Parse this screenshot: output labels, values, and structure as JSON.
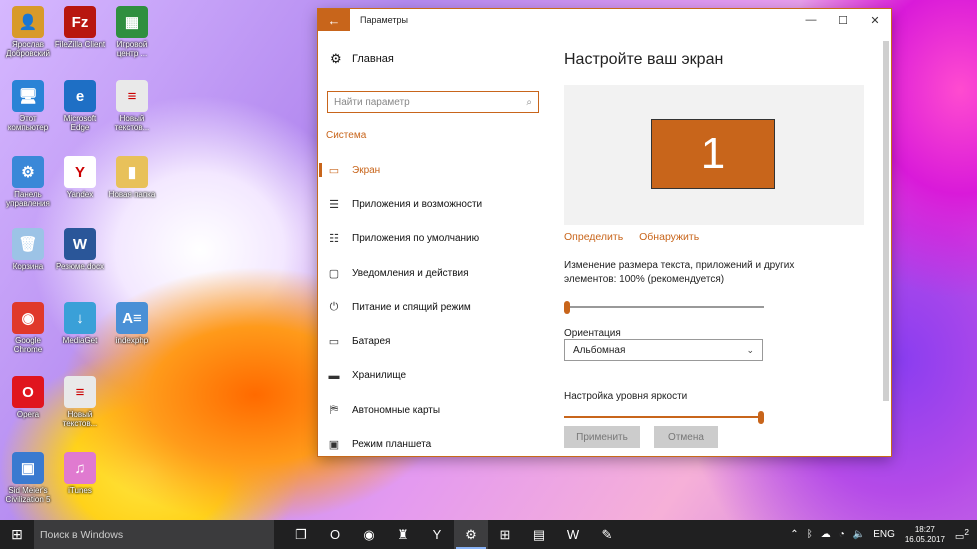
{
  "desktop": {
    "icons": [
      {
        "label": "Ярослав Добровский",
        "glyph": "👤",
        "color": "#d89a2a"
      },
      {
        "label": "FileZilla Client",
        "glyph": "Fz",
        "color": "#b8160f"
      },
      {
        "label": "Игровой центр ...",
        "glyph": "▦",
        "color": "#2f8f3f"
      },
      {
        "label": "Этот компьютер",
        "glyph": "🖥",
        "color": "#2a83d6"
      },
      {
        "label": "Microsoft Edge",
        "glyph": "e",
        "color": "#1e6fc5"
      },
      {
        "label": "Новый текстов...",
        "glyph": "≡",
        "color": "#e9e9e9"
      },
      {
        "label": "Панель управления",
        "glyph": "⚙",
        "color": "#3a88d8"
      },
      {
        "label": "Yandex",
        "glyph": "Y",
        "color": "#ffffff"
      },
      {
        "label": "Новая папка",
        "glyph": "▮",
        "color": "#e8c15a"
      },
      {
        "label": "Корзина",
        "glyph": "🗑",
        "color": "#9cc3e6"
      },
      {
        "label": "Резюме.docx",
        "glyph": "W",
        "color": "#2a5699"
      },
      {
        "label": "Google Chrome",
        "glyph": "◉",
        "color": "#e0392b"
      },
      {
        "label": "MediaGet",
        "glyph": "↓",
        "color": "#3aa0d8"
      },
      {
        "label": "indexphp",
        "glyph": "A≡",
        "color": "#4a90d6"
      },
      {
        "label": "Opera",
        "glyph": "O",
        "color": "#e0151e"
      },
      {
        "label": "Новый текстов...",
        "glyph": "≡",
        "color": "#e9e9e9"
      },
      {
        "label": "Sid Meier's Civilization 5",
        "glyph": "▣",
        "color": "#3a7ad0"
      },
      {
        "label": "iTunes",
        "glyph": "♫",
        "color": "#e07ad0"
      }
    ]
  },
  "window": {
    "title": "Параметры",
    "back_glyph": "←",
    "minimize": "—",
    "maximize": "☐",
    "close": "✕",
    "sidebar": {
      "home_label": "Главная",
      "search_placeholder": "Найти параметр",
      "section": "Система",
      "items": [
        {
          "label": "Экран",
          "icon": "monitor-icon",
          "glyph": "▭"
        },
        {
          "label": "Приложения и возможности",
          "icon": "list-icon",
          "glyph": "☰"
        },
        {
          "label": "Приложения по умолчанию",
          "icon": "defaults-icon",
          "glyph": "☷"
        },
        {
          "label": "Уведомления и действия",
          "icon": "notification-icon",
          "glyph": "▢"
        },
        {
          "label": "Питание и спящий режим",
          "icon": "power-icon",
          "glyph": "⏻"
        },
        {
          "label": "Батарея",
          "icon": "battery-icon",
          "glyph": "▭"
        },
        {
          "label": "Хранилище",
          "icon": "storage-icon",
          "glyph": "▬"
        },
        {
          "label": "Автономные карты",
          "icon": "map-icon",
          "glyph": "⛿"
        },
        {
          "label": "Режим планшета",
          "icon": "tablet-icon",
          "glyph": "▣"
        }
      ]
    },
    "main": {
      "title": "Настройте ваш экран",
      "display_number": "1",
      "identify_link": "Определить",
      "detect_link": "Обнаружить",
      "scale_label": "Изменение размера текста, приложений и других элементов: 100% (рекомендуется)",
      "scale_value": 0,
      "orientation_label": "Ориентация",
      "orientation_value": "Альбомная",
      "brightness_label": "Настройка уровня яркости",
      "brightness_value": 1,
      "apply_label": "Применить",
      "cancel_label": "Отмена"
    }
  },
  "taskbar": {
    "search_text": "Поиск в Windows",
    "apps": [
      {
        "name": "task-view",
        "glyph": "❐"
      },
      {
        "name": "opera",
        "glyph": "O"
      },
      {
        "name": "chrome",
        "glyph": "◉"
      },
      {
        "name": "wot",
        "glyph": "♜"
      },
      {
        "name": "yandex",
        "glyph": "Y"
      },
      {
        "name": "settings",
        "glyph": "⚙"
      },
      {
        "name": "store",
        "glyph": "⊞"
      },
      {
        "name": "explorer",
        "glyph": "▤"
      },
      {
        "name": "word",
        "glyph": "W"
      },
      {
        "name": "paint",
        "glyph": "✎"
      }
    ],
    "tray": {
      "chevron": "⌃",
      "lang": "ENG",
      "time": "18:27",
      "date": "16.05.2017",
      "notifications": "2"
    }
  }
}
